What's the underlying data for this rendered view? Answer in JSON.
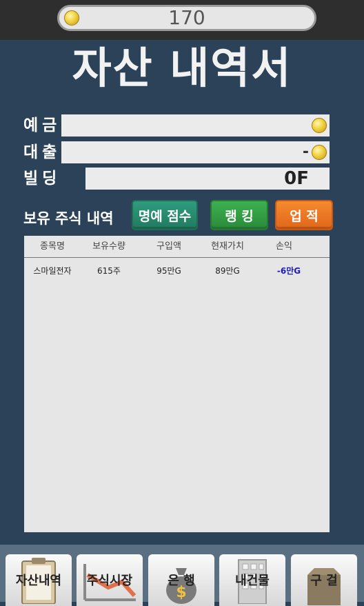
{
  "header": {
    "coin_amount": "170"
  },
  "title": "자산 내역서",
  "fields": {
    "deposit_label": "예금",
    "deposit_value": "",
    "loan_label": "대출",
    "loan_value": "-",
    "building_label": "빌딩",
    "building_value": "0F"
  },
  "section": {
    "holdings_label": "보유 주식 내역"
  },
  "buttons": {
    "honor_label": "명예 점수",
    "ranking_label": "랭 킹",
    "achievement_label": "업 적"
  },
  "table": {
    "columns": [
      "종목명",
      "보유수량",
      "구입액",
      "현재가치",
      "손익"
    ],
    "rows": [
      [
        "스마일전자",
        "615주",
        "95만G",
        "89만G",
        "-6만G"
      ]
    ]
  },
  "tabs": [
    "자산내역",
    "주식시장",
    "은 행",
    "내건물",
    "구 걸"
  ],
  "colors": {
    "background": "#2c4258",
    "loss": "#1a1ac8",
    "honor": "#2f9c7e",
    "ranking": "#3db14f",
    "achievement": "#f58a2e"
  },
  "icons": [
    "coin-icon",
    "clipboard-icon",
    "stock-chart-icon",
    "money-bag-icon",
    "building-icon",
    "box-icon"
  ]
}
